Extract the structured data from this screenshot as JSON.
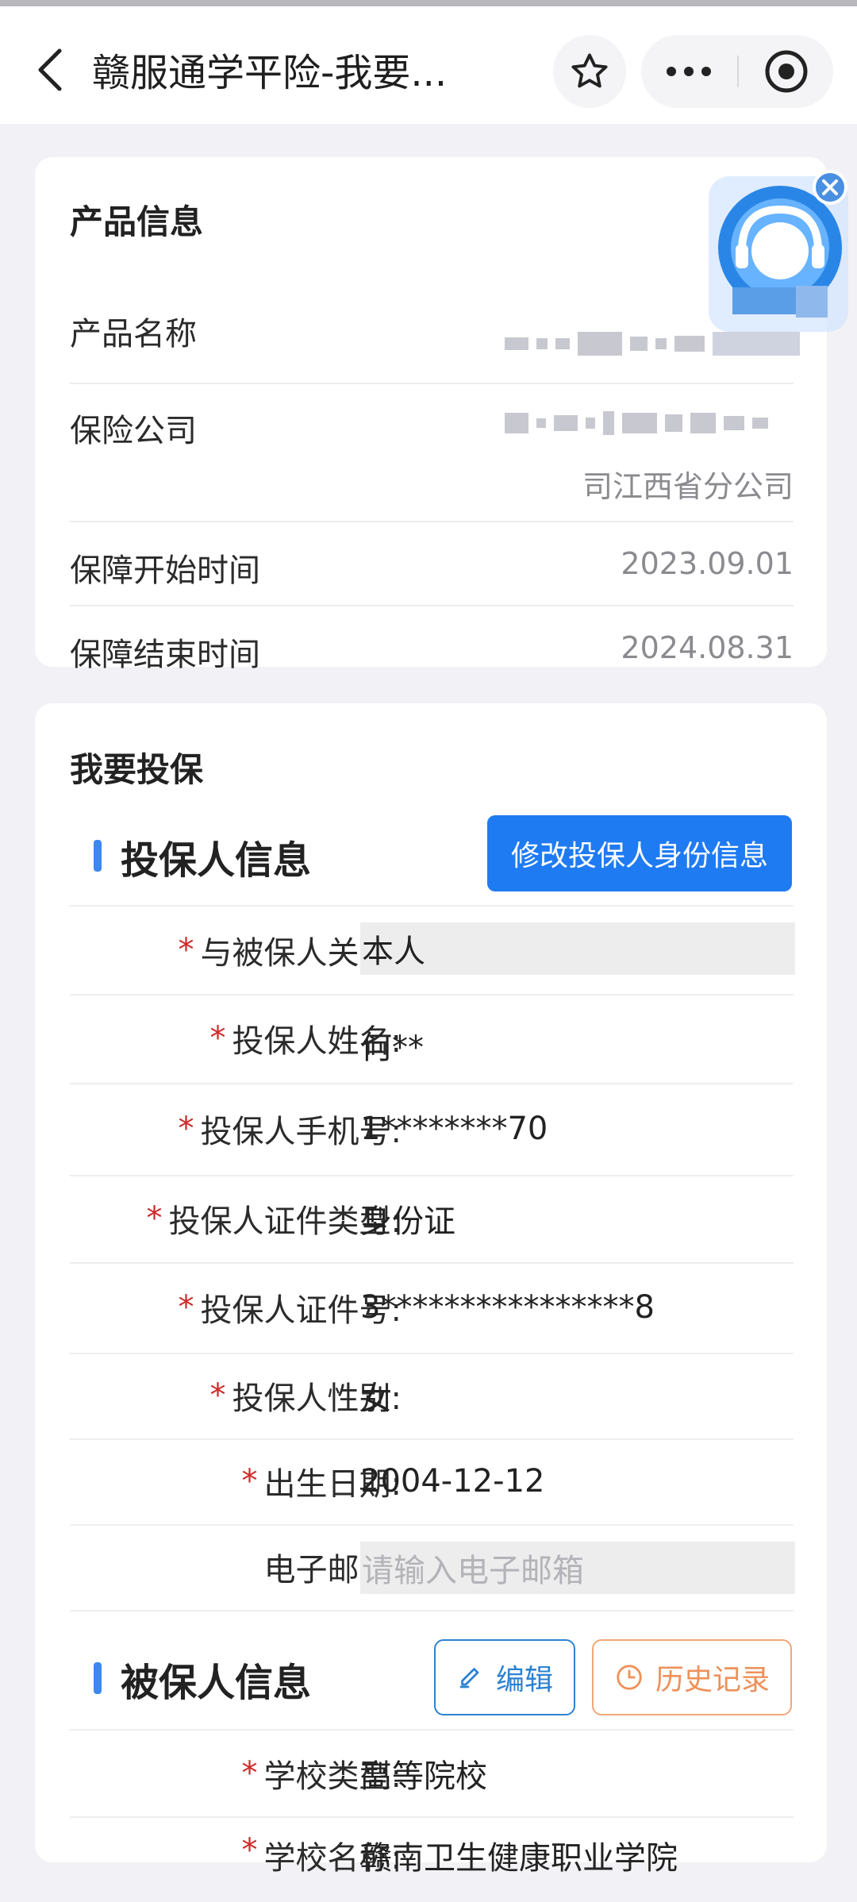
{
  "nav": {
    "title": "赣服通学平险-我要..."
  },
  "product": {
    "section_title": "产品信息",
    "rows": [
      {
        "label": "产品名称",
        "value": ""
      },
      {
        "label": "保险公司",
        "value": "司江西省分公司"
      },
      {
        "label": "保障开始时间",
        "value": "2023.09.01"
      },
      {
        "label": "保障结束时间",
        "value": "2024.08.31"
      }
    ]
  },
  "apply": {
    "section_title": "我要投保",
    "applicant_header": "投保人信息",
    "edit_identity_button": "修改投保人身份信息",
    "fields": [
      {
        "label": "与被保人关系:",
        "value": "本人",
        "required": "*"
      },
      {
        "label": "投保人姓名:",
        "value": "何**",
        "required": "*"
      },
      {
        "label": "投保人手机号:",
        "value": "1********70",
        "required": "*"
      },
      {
        "label": "投保人证件类型:",
        "value": "身份证",
        "required": "*"
      },
      {
        "label": "投保人证件号:",
        "value": "3****************8",
        "required": "*"
      },
      {
        "label": "投保人性别:",
        "value": "女",
        "required": "*"
      },
      {
        "label": "出生日期:",
        "value": "2004-12-12",
        "required": "*"
      },
      {
        "label": "电子邮箱:",
        "placeholder": "请输入电子邮箱",
        "required": ""
      }
    ],
    "insured_header": "被保人信息",
    "edit_button": "编辑",
    "history_button": "历史记录",
    "insured_fields": [
      {
        "label": "学校类型:",
        "value": "高等院校",
        "required": "*"
      },
      {
        "label": "学校名称:",
        "value": "赣南卫生健康职业学院",
        "required": "*"
      }
    ]
  },
  "colors": {
    "accent_blue": "#1f7bf2",
    "required_red": "#d02a2a",
    "history_orange": "#ee9159"
  }
}
